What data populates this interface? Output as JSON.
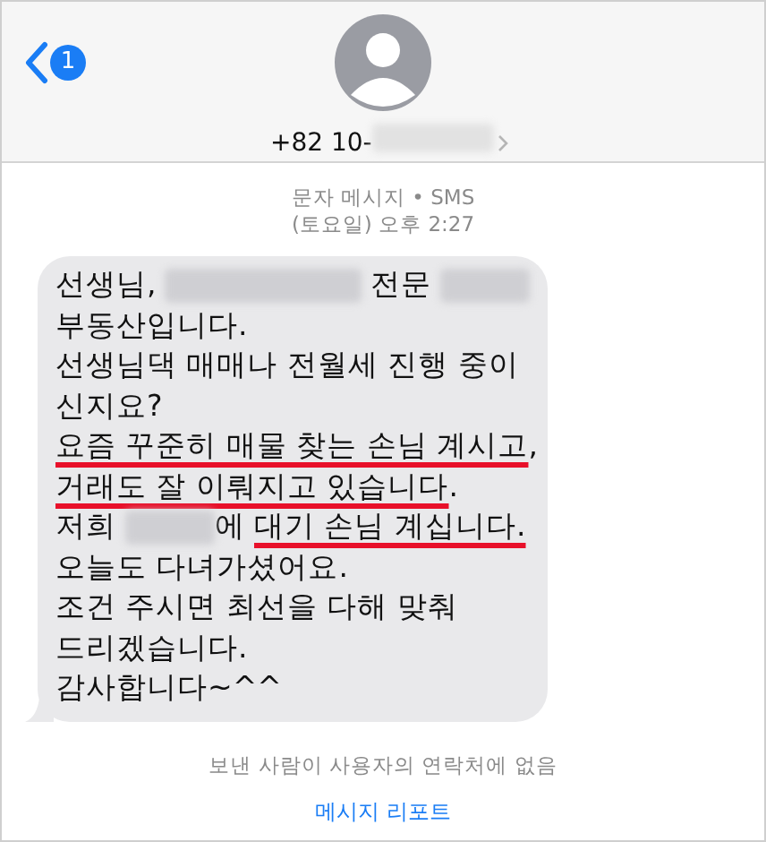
{
  "header": {
    "back_badge": "1",
    "phone_prefix": "+82 10-",
    "phone_redacted": true
  },
  "message_meta": {
    "type_line": "문자 메시지 • SMS",
    "time_line": "(토요일) 오후 2:27"
  },
  "message": {
    "lines": [
      {
        "segments": [
          {
            "kind": "text",
            "text": "선생님,",
            "underlined": false
          },
          {
            "kind": "redaction"
          },
          {
            "kind": "text",
            "text": "전문",
            "underlined": false
          },
          {
            "kind": "redaction"
          }
        ]
      },
      {
        "segments": [
          {
            "kind": "text",
            "text": "부동산입니다.",
            "underlined": false
          }
        ]
      },
      {
        "segments": [
          {
            "kind": "text",
            "text": "선생님댁 매매나 전월세 진행 중이",
            "underlined": false
          }
        ]
      },
      {
        "segments": [
          {
            "kind": "text",
            "text": "신지요?",
            "underlined": false
          }
        ]
      },
      {
        "segments": [
          {
            "kind": "text",
            "text": "요즘 꾸준히 매물 찾는 손님 계시고",
            "underlined": true
          },
          {
            "kind": "text",
            "text": ",",
            "underlined": false
          }
        ]
      },
      {
        "segments": [
          {
            "kind": "text",
            "text": "거래도 잘 이뤄지고 있습니다",
            "underlined": true
          },
          {
            "kind": "text",
            "text": ".",
            "underlined": false
          }
        ]
      },
      {
        "segments": [
          {
            "kind": "text",
            "text": "저희",
            "underlined": false
          },
          {
            "kind": "redaction"
          },
          {
            "kind": "text",
            "text": "에",
            "underlined": false
          },
          {
            "kind": "text",
            "text": "대기 손님 계십니다.",
            "underlined": true
          }
        ]
      },
      {
        "segments": [
          {
            "kind": "text",
            "text": "오늘도 다녀가셨어요.",
            "underlined": false
          }
        ]
      },
      {
        "segments": [
          {
            "kind": "text",
            "text": "조건 주시면 최선을 다해 맞춰",
            "underlined": false
          }
        ]
      },
      {
        "segments": [
          {
            "kind": "text",
            "text": "드리겠습니다.",
            "underlined": false
          }
        ]
      },
      {
        "segments": [
          {
            "kind": "text",
            "text": "감사합니다~^^",
            "underlined": false
          }
        ]
      }
    ]
  },
  "footer": {
    "notice": "보낸 사람이 사용자의 연락처에 없음",
    "report_link": "메시지 리포트"
  }
}
